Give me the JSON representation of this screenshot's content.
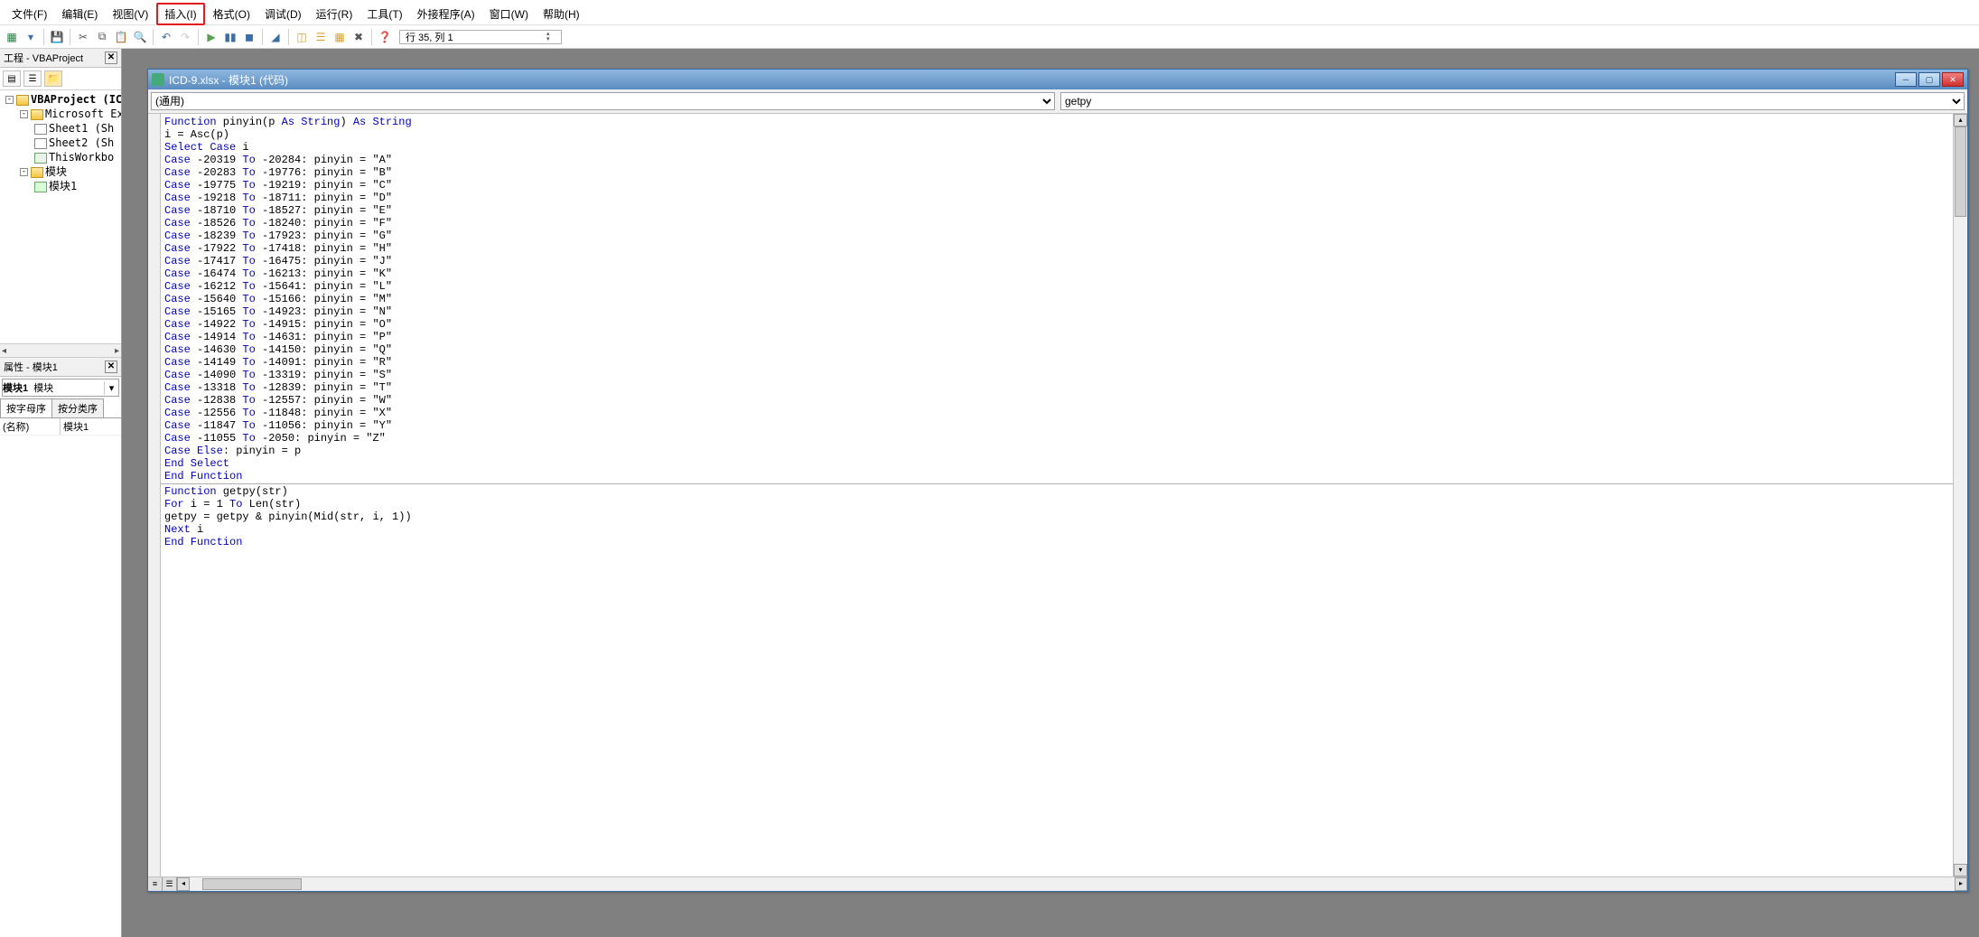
{
  "menu": {
    "file": "文件(F)",
    "edit": "编辑(E)",
    "view": "视图(V)",
    "insert": "插入(I)",
    "format": "格式(O)",
    "debug": "调试(D)",
    "run": "运行(R)",
    "tools": "工具(T)",
    "addins": "外接程序(A)",
    "window": "窗口(W)",
    "help": "帮助(H)"
  },
  "toolbar": {
    "cursor_pos": "行 35, 列 1"
  },
  "project_pane": {
    "title": "工程 - VBAProject",
    "root": "VBAProject (IC",
    "excel_objects": "Microsoft Exc",
    "sheet1": "Sheet1 (Sh",
    "sheet2": "Sheet2 (Sh",
    "thisworkbook": "ThisWorkbo",
    "modules": "模块",
    "module1": "模块1"
  },
  "properties_pane": {
    "title": "属性 - 模块1",
    "object_name": "模块1",
    "object_type": "模块",
    "tab_alpha": "按字母序",
    "tab_cat": "按分类序",
    "prop_name_key": "(名称)",
    "prop_name_val": "模块1"
  },
  "code_window": {
    "title": "ICD-9.xlsx - 模块1 (代码)",
    "left_dropdown": "(通用)",
    "right_dropdown": "getpy",
    "code_tokens": [
      [
        "Function",
        " pinyin(p ",
        "As String",
        ") ",
        "As String"
      ],
      [
        "",
        "i = Asc(p)"
      ],
      [
        "Select Case",
        " i"
      ],
      [
        "Case",
        " -20319 ",
        "To",
        " -20284: pinyin = \"A\""
      ],
      [
        "Case",
        " -20283 ",
        "To",
        " -19776: pinyin = \"B\""
      ],
      [
        "Case",
        " -19775 ",
        "To",
        " -19219: pinyin = \"C\""
      ],
      [
        "Case",
        " -19218 ",
        "To",
        " -18711: pinyin = \"D\""
      ],
      [
        "Case",
        " -18710 ",
        "To",
        " -18527: pinyin = \"E\""
      ],
      [
        "Case",
        " -18526 ",
        "To",
        " -18240: pinyin = \"F\""
      ],
      [
        "Case",
        " -18239 ",
        "To",
        " -17923: pinyin = \"G\""
      ],
      [
        "Case",
        " -17922 ",
        "To",
        " -17418: pinyin = \"H\""
      ],
      [
        "Case",
        " -17417 ",
        "To",
        " -16475: pinyin = \"J\""
      ],
      [
        "Case",
        " -16474 ",
        "To",
        " -16213: pinyin = \"K\""
      ],
      [
        "Case",
        " -16212 ",
        "To",
        " -15641: pinyin = \"L\""
      ],
      [
        "Case",
        " -15640 ",
        "To",
        " -15166: pinyin = \"M\""
      ],
      [
        "Case",
        " -15165 ",
        "To",
        " -14923: pinyin = \"N\""
      ],
      [
        "Case",
        " -14922 ",
        "To",
        " -14915: pinyin = \"O\""
      ],
      [
        "Case",
        " -14914 ",
        "To",
        " -14631: pinyin = \"P\""
      ],
      [
        "Case",
        " -14630 ",
        "To",
        " -14150: pinyin = \"Q\""
      ],
      [
        "Case",
        " -14149 ",
        "To",
        " -14091: pinyin = \"R\""
      ],
      [
        "Case",
        " -14090 ",
        "To",
        " -13319: pinyin = \"S\""
      ],
      [
        "Case",
        " -13318 ",
        "To",
        " -12839: pinyin = \"T\""
      ],
      [
        "Case",
        " -12838 ",
        "To",
        " -12557: pinyin = \"W\""
      ],
      [
        "Case",
        " -12556 ",
        "To",
        " -11848: pinyin = \"X\""
      ],
      [
        "Case",
        " -11847 ",
        "To",
        " -11056: pinyin = \"Y\""
      ],
      [
        "Case",
        " -11055 ",
        "To",
        " -2050: pinyin = \"Z\""
      ],
      [
        "Case Else",
        ": pinyin = p"
      ],
      [
        "End Select",
        ""
      ],
      [
        "End Function",
        ""
      ],
      [
        "__HR__"
      ],
      [
        "Function",
        " getpy(str)"
      ],
      [
        "For",
        " i = 1 ",
        "To",
        " Len(str)"
      ],
      [
        "",
        "getpy = getpy & pinyin(Mid(str, i, 1))"
      ],
      [
        "Next",
        " i"
      ],
      [
        "End Function",
        ""
      ]
    ]
  }
}
